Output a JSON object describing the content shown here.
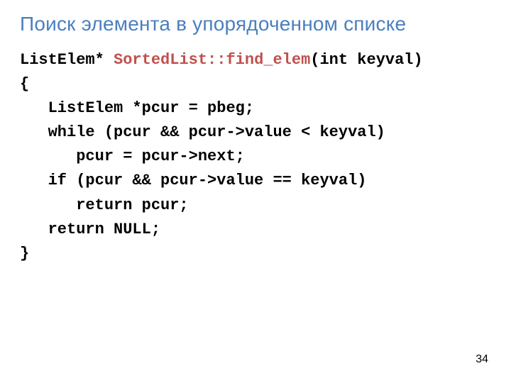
{
  "title": "Поиск элемента в упорядоченном списке",
  "code": {
    "l1a": "ListElem* ",
    "l1b": "SortedList::find_elem",
    "l1c": "(int keyval)",
    "l2": "{",
    "l3": "   ListElem *pcur = pbeg;",
    "l4": "   while (pcur && pcur->value < keyval)",
    "l5": "      pcur = pcur->next;",
    "l6": "   if (pcur && pcur->value == keyval)",
    "l7": "      return pcur;",
    "l8": "   return NULL;",
    "l9": "}"
  },
  "page_number": "34"
}
